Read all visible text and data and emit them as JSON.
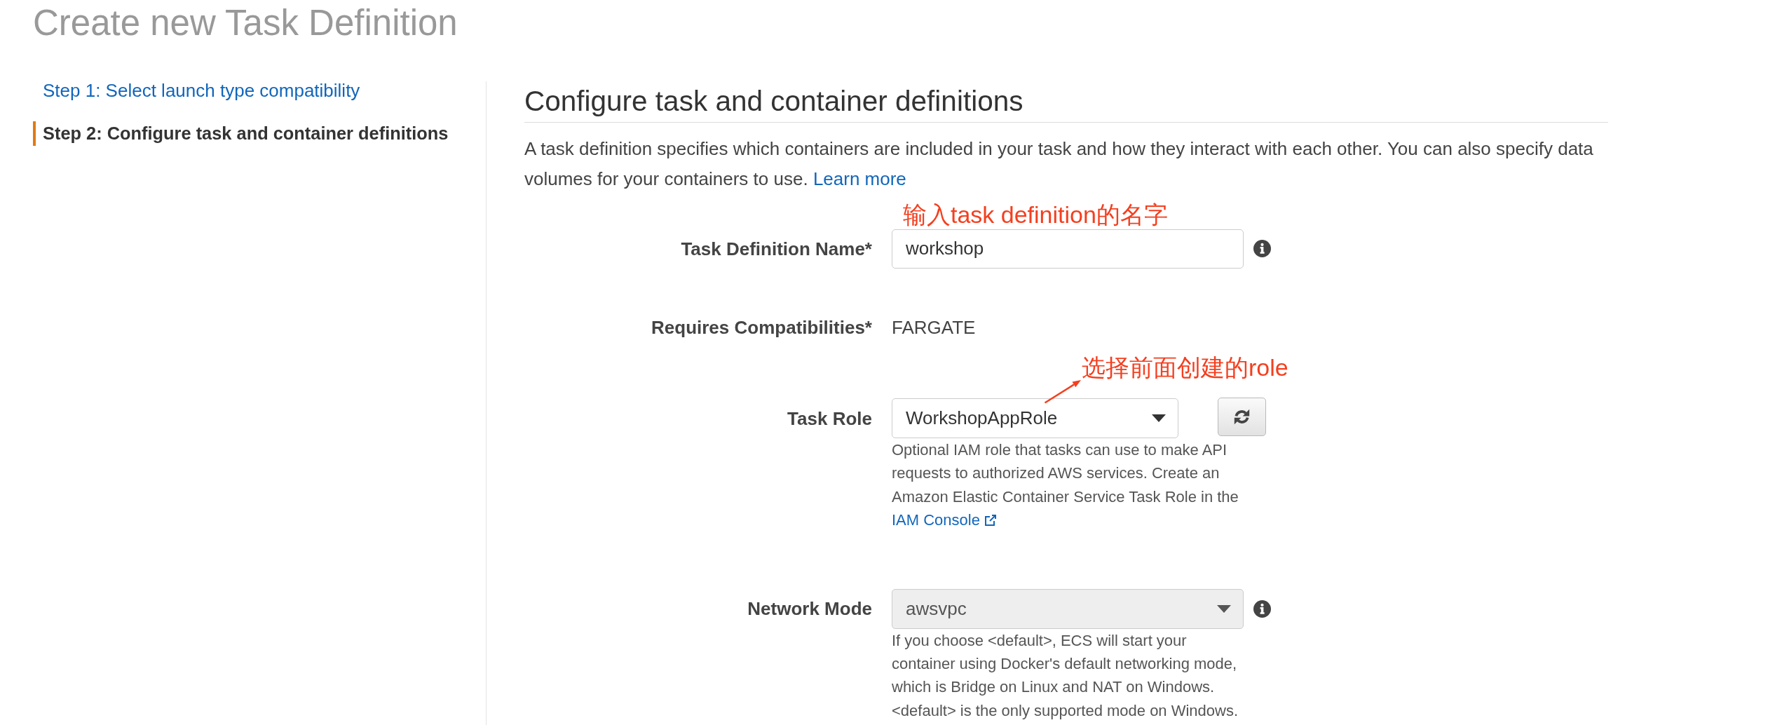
{
  "page_title": "Create new Task Definition",
  "steps": [
    {
      "label": "Step 1: Select launch type compatibility",
      "selected": false
    },
    {
      "label": "Step 2: Configure task and container definitions",
      "selected": true
    }
  ],
  "section": {
    "title": "Configure task and container definitions",
    "description": "A task definition specifies which containers are included in your task and how they interact with each other. You can also specify data volumes for your containers to use.",
    "link": "Learn more"
  },
  "fields": [
    {
      "kind": "text",
      "label": "Task Definition Name*",
      "value": "workshop",
      "disabled": false,
      "info": true,
      "annotation": {
        "text": "输入task definition的名字",
        "arrow": false
      }
    },
    {
      "kind": "static",
      "label": "Requires Compatibilities*",
      "value": "FARGATE"
    },
    {
      "kind": "select",
      "label": "Task Role",
      "value": "WorkshopAppRole",
      "disabled": false,
      "refresh": true,
      "annotation": {
        "text": "选择前面创建的role",
        "arrow": true
      },
      "help": "Optional IAM role that tasks can use to make API requests to authorized AWS services. Create an Amazon Elastic Container Service Task Role in the",
      "help_link": "IAM Console"
    },
    {
      "kind": "select",
      "label": "Network Mode",
      "value": "awsvpc",
      "disabled": true,
      "info": true,
      "help": "If you choose <default>, ECS will start your container using Docker's default networking mode, which is Bridge on Linux and NAT on Windows. <default> is the only supported mode on Windows."
    }
  ]
}
